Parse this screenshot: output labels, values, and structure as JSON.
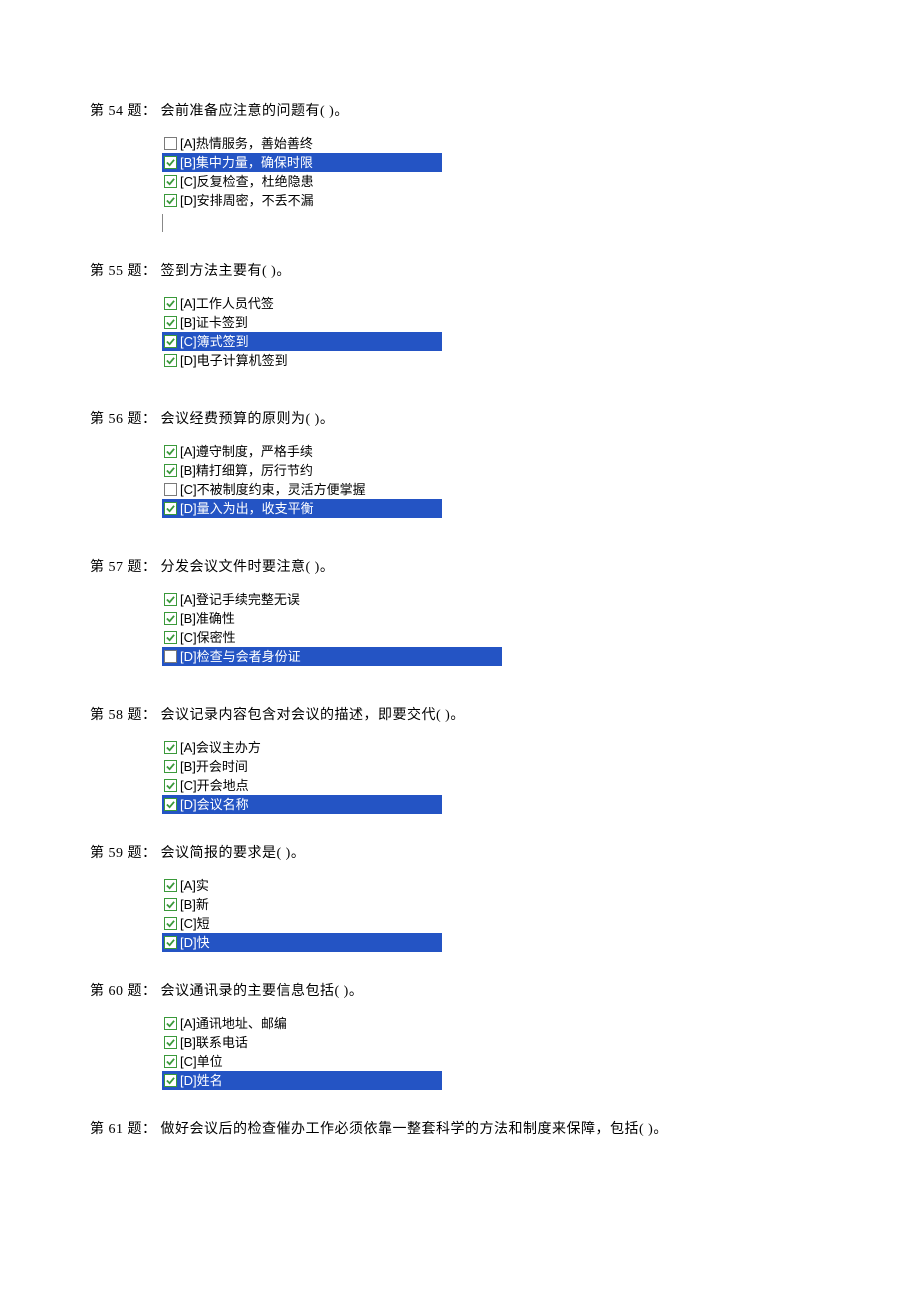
{
  "questions": [
    {
      "number": "第 54 题：",
      "text": "会前准备应注意的问题有(   )。",
      "options": [
        {
          "label": "[A]热情服务，善始善终",
          "checked": false,
          "highlighted": false
        },
        {
          "label": "[B]集中力量，确保时限",
          "checked": true,
          "highlighted": true
        },
        {
          "label": "[C]反复检查，杜绝隐患",
          "checked": true,
          "highlighted": false
        },
        {
          "label": "[D]安排周密，不丢不漏",
          "checked": true,
          "highlighted": false
        }
      ],
      "hasDivider": true
    },
    {
      "number": "第 55 题：",
      "text": "签到方法主要有(   )。",
      "options": [
        {
          "label": "[A]工作人员代签",
          "checked": true,
          "highlighted": false
        },
        {
          "label": "[B]证卡签到",
          "checked": true,
          "highlighted": false
        },
        {
          "label": "[C]簿式签到",
          "checked": true,
          "highlighted": true
        },
        {
          "label": "[D]电子计算机签到",
          "checked": true,
          "highlighted": false
        }
      ],
      "hasDivider": false
    },
    {
      "number": "第 56 题：",
      "text": "会议经费预算的原则为(   )。",
      "options": [
        {
          "label": "[A]遵守制度，严格手续",
          "checked": true,
          "highlighted": false
        },
        {
          "label": "[B]精打细算，厉行节约",
          "checked": true,
          "highlighted": false
        },
        {
          "label": "[C]不被制度约束，灵活方便掌握",
          "checked": false,
          "highlighted": false
        },
        {
          "label": "[D]量入为出，收支平衡",
          "checked": true,
          "highlighted": true
        }
      ],
      "hasDivider": false,
      "extraSpace": true
    },
    {
      "number": "第 57 题：",
      "text": "分发会议文件时要注意(   )。",
      "options": [
        {
          "label": "[A]登记手续完整无误",
          "checked": true,
          "highlighted": false
        },
        {
          "label": "[B]准确性",
          "checked": true,
          "highlighted": false
        },
        {
          "label": "[C]保密性",
          "checked": true,
          "highlighted": false
        },
        {
          "label": "[D]检查与会者身份证",
          "checked": false,
          "highlighted": true,
          "wide": true
        }
      ],
      "hasDivider": false,
      "extraSpace": true
    },
    {
      "number": "第 58 题：",
      "text": "会议记录内容包含对会议的描述，即要交代(   )。",
      "options": [
        {
          "label": "[A]会议主办方",
          "checked": true,
          "highlighted": false
        },
        {
          "label": "[B]开会时间",
          "checked": true,
          "highlighted": false
        },
        {
          "label": "[C]开会地点",
          "checked": true,
          "highlighted": false
        },
        {
          "label": "[D]会议名称",
          "checked": true,
          "highlighted": true
        }
      ],
      "hasDivider": false,
      "extraSpace": true
    },
    {
      "number": "第 59 题：",
      "text": "会议简报的要求是(   )。",
      "options": [
        {
          "label": "[A]实",
          "checked": true,
          "highlighted": false
        },
        {
          "label": "[B]新",
          "checked": true,
          "highlighted": false
        },
        {
          "label": "[C]短",
          "checked": true,
          "highlighted": false
        },
        {
          "label": "[D]快",
          "checked": true,
          "highlighted": true
        }
      ],
      "hasDivider": false
    },
    {
      "number": "第 60 题：",
      "text": "会议通讯录的主要信息包括(   )。",
      "options": [
        {
          "label": "[A]通讯地址、邮编",
          "checked": true,
          "highlighted": false
        },
        {
          "label": "[B]联系电话",
          "checked": true,
          "highlighted": false
        },
        {
          "label": "[C]单位",
          "checked": true,
          "highlighted": false
        },
        {
          "label": "[D]姓名",
          "checked": true,
          "highlighted": true
        }
      ],
      "hasDivider": false
    },
    {
      "number": "第 61 题：",
      "text": "做好会议后的检查催办工作必须依靠一整套科学的方法和制度来保障，包括(   )。",
      "options": [],
      "hasDivider": false
    }
  ]
}
